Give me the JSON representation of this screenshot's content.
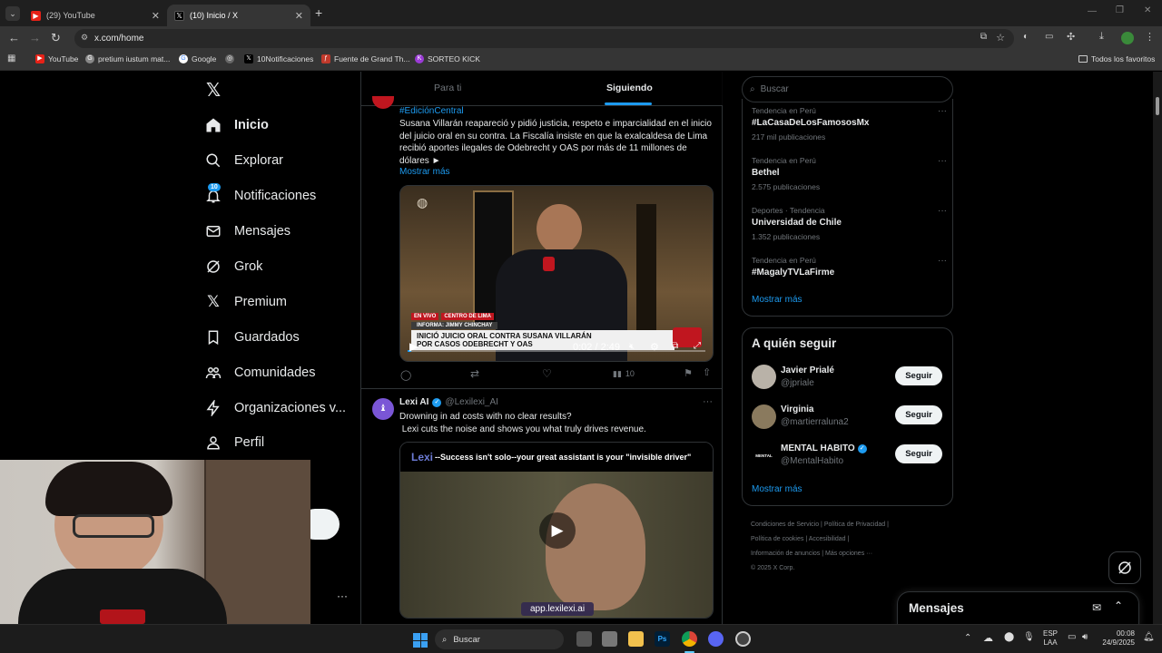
{
  "browser": {
    "tabs": [
      {
        "title": "(29) YouTube"
      },
      {
        "title": "(10) Inicio / X"
      }
    ],
    "url": "x.com/home",
    "bookmarks": [
      "YouTube",
      "pretium iustum mat...",
      "Google",
      "",
      "10Notificaciones",
      "Fuente de Grand Th...",
      "SORTEO KICK"
    ],
    "all_bookmarks": "Todos los favoritos"
  },
  "nav": {
    "items": [
      {
        "label": "Inicio",
        "icon": "home-icon"
      },
      {
        "label": "Explorar",
        "icon": "search-icon"
      },
      {
        "label": "Notificaciones",
        "icon": "bell-icon",
        "badge": "10"
      },
      {
        "label": "Mensajes",
        "icon": "mail-icon"
      },
      {
        "label": "Grok",
        "icon": "grok-icon"
      },
      {
        "label": "Premium",
        "icon": "x-icon"
      },
      {
        "label": "Guardados",
        "icon": "bookmark-icon"
      },
      {
        "label": "Comunidades",
        "icon": "people-icon"
      },
      {
        "label": "Organizaciones v...",
        "icon": "lightning-icon"
      },
      {
        "label": "Perfil",
        "icon": "person-icon"
      }
    ],
    "more": "···"
  },
  "feed": {
    "tabs": [
      "Para ti",
      "Siguiendo"
    ],
    "post1": {
      "hashtag": "#EdiciónCentral",
      "text": "Susana Villarán reapareció y pidió justicia, respeto e imparcialidad en el inicio del juicio oral en su contra. La Fiscalía insiste en que la exalcaldesa de Lima recibió aportes ilegales de Odebrecht y OAS por más de 11 millones de dólares ►",
      "show_more": "Mostrar más",
      "video": {
        "live": "EN VIVO",
        "place": "CENTRO DE LIMA",
        "reporter": "INFORMA: JIMMY CHINCHAY",
        "headline1": "INICIÓ JUICIO ORAL CONTRA SUSANA VILLARÁN",
        "headline2": "POR CASOS ODEBRECHT Y OAS",
        "time": "0:02 / 2:49",
        "progress": 0.012
      },
      "views": "10"
    },
    "post2": {
      "name": "Lexi AI",
      "handle": "@Lexilexi_AI",
      "line1": "Drowning in ad costs with no clear results?",
      "line2": " Lexi cuts the noise and shows you what truly drives revenue.",
      "banner_brand": "Lexi",
      "banner_text": "--Success isn't solo--your great assistant is your \"invisible driver\"",
      "url": "app.lexilexi.ai"
    }
  },
  "sidebar": {
    "search_placeholder": "Buscar",
    "trends": [
      {
        "context": "Tendencia en Perú",
        "name": "#LaCasaDeLosFamososMx",
        "count": "217 mil publicaciones"
      },
      {
        "context": "Tendencia en Perú",
        "name": "Bethel",
        "count": "2.575 publicaciones"
      },
      {
        "context": "Deportes · Tendencia",
        "name": "Universidad de Chile",
        "count": "1.352 publicaciones"
      },
      {
        "context": "Tendencia en Perú",
        "name": "#MagalyTVLaFirme",
        "count": ""
      }
    ],
    "trends_more": "Mostrar más",
    "who_title": "A quién seguir",
    "who": [
      {
        "name": "Javier Prialé",
        "handle": "@jpriale",
        "btn": "Seguir"
      },
      {
        "name": "Virginia",
        "handle": "@martierraluna2",
        "btn": "Seguir"
      },
      {
        "name": "MENTAL HABITO",
        "handle": "@MentalHabito",
        "btn": "Seguir"
      }
    ],
    "who_more": "Mostrar más",
    "footer": [
      "Condiciones de Servicio",
      "Política de Privacidad",
      "Política de cookies",
      "Accesibilidad",
      "Información de anuncios",
      "Más opciones ···",
      "© 2025 X Corp."
    ],
    "messages": "Mensajes"
  },
  "taskbar": {
    "search": "Buscar",
    "lang1": "ESP",
    "lang2": "LAA",
    "time": "00:08",
    "date": "24/9/2025"
  },
  "colors": {
    "accent": "#1d9bf0",
    "bg": "#000000",
    "border": "#2f3336"
  }
}
